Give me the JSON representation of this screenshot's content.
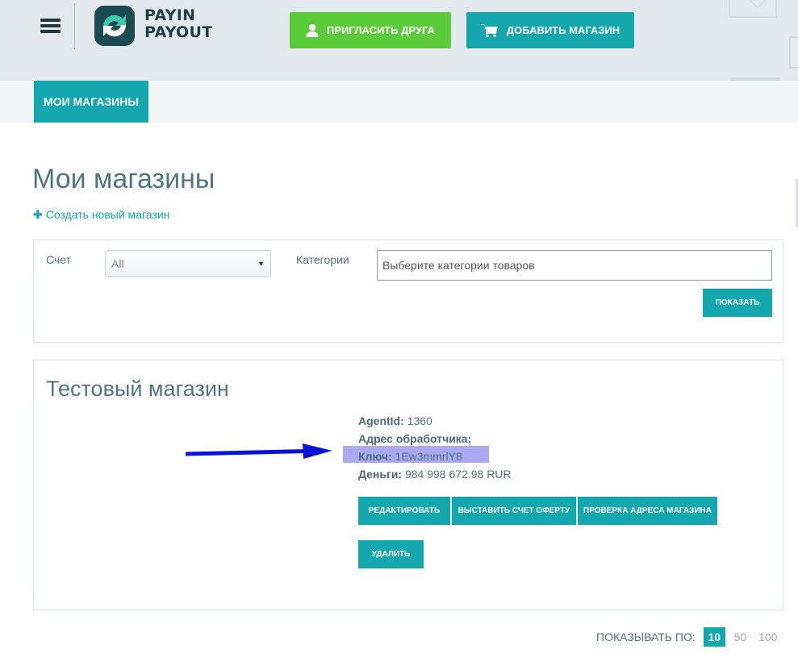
{
  "header": {
    "logo_line1": "PAYIN",
    "logo_line2": "PAYOUT",
    "invite_button": "ПРИГЛАСИТЬ ДРУГА",
    "add_shop_button": "ДОБАВИТЬ МАГАЗИН",
    "invite_icon": "user-icon",
    "add_shop_icon": "cart-icon"
  },
  "tabs": [
    {
      "label": "МОИ МАГАЗИНЫ",
      "active": true
    }
  ],
  "page": {
    "title": "Мои магазины",
    "create_link": "Создать новый магазин"
  },
  "filter": {
    "account_label": "Счет",
    "account_value": "All",
    "categories_label": "Категории",
    "categories_placeholder": "Выберите категории товаров",
    "show_button": "ПОКАЗАТЬ"
  },
  "store": {
    "name": "Тестовый магазин",
    "agent_id_label": "AgentId:",
    "agent_id_value": "1360",
    "handler_label": "Адрес обработчика:",
    "handler_value": "",
    "key_label": "Ключ:",
    "key_value": "1Ew3mmrlY8",
    "money_label": "Деньги:",
    "money_value": "984 998 672.98 RUR",
    "buttons": {
      "edit": "РЕДАКТИРОВАТЬ",
      "invoice": "ВЫСТАВИТЬ СЧЕТ ОФЕРТУ",
      "check": "ПРОВЕРКА АДРЕСА МАГАЗИНА",
      "delete": "УДАЛИТЬ"
    }
  },
  "pagination": {
    "label": "ПОКАЗЫВАТЬ ПО:",
    "options": [
      "10",
      "50",
      "100"
    ],
    "selected": "10"
  },
  "colors": {
    "accent": "#14a7ad",
    "invite_green": "#5ccb3a",
    "annotation_arrow": "#0a14d8",
    "key_highlight": "#aaaaf2"
  }
}
